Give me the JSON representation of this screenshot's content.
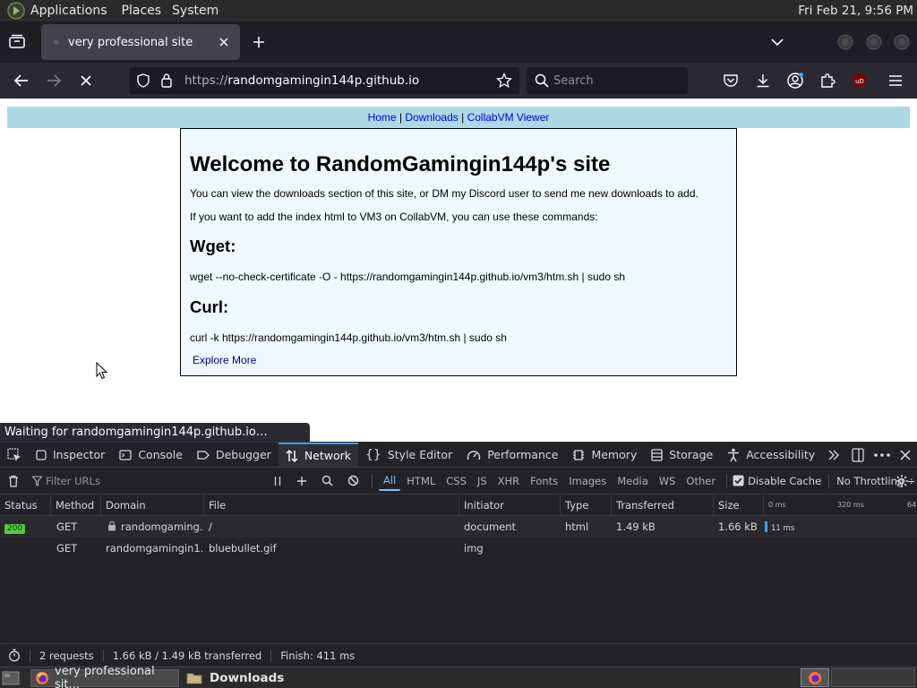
{
  "panel": {
    "menus": [
      "Applications",
      "Places",
      "System"
    ],
    "clock": "Fri Feb 21,  9:56 PM"
  },
  "tab": {
    "title": "very professional site"
  },
  "navbar": {
    "url_prefix": "https://",
    "url_host": "randomgamingin144p.github.io",
    "search_placeholder": "Search"
  },
  "page": {
    "nav": {
      "home": "Home",
      "sep1": " | ",
      "downloads": "Downloads",
      "sep2": " | ",
      "collabvm": "CollabVM Viewer"
    },
    "heading": "Welcome to RandomGamingin144p's site",
    "p1": "You can view the downloads section of this site, or DM my Discord user to send me new downloads to add.",
    "p2": "If you want to add the index html to VM3 on CollabVM, you can use these commands:",
    "wget_heading": "Wget:",
    "wget_cmd": "wget --no-check-certificate -O - https://randomgamingin144p.github.io/vm3/htm.sh | sudo sh",
    "curl_heading": "Curl:",
    "curl_cmd": "curl -k https://randomgamingin144p.github.io/vm3/htm.sh | sudo sh",
    "explore": "Explore More"
  },
  "status_popup": "Waiting for randomgamingin144p.github.io…",
  "devtools": {
    "tabs": [
      "Inspector",
      "Console",
      "Debugger",
      "Network",
      "Style Editor",
      "Performance",
      "Memory",
      "Storage",
      "Accessibility"
    ],
    "active_tab": "Network",
    "filter_placeholder": "Filter URLs",
    "filter_types": [
      "All",
      "HTML",
      "CSS",
      "JS",
      "XHR",
      "Fonts",
      "Images",
      "Media",
      "WS",
      "Other"
    ],
    "disable_cache": "Disable Cache",
    "throttling": "No Throttling ÷",
    "columns": [
      "Status",
      "Method",
      "Domain",
      "File",
      "Initiator",
      "Type",
      "Transferred",
      "Size"
    ],
    "timeline_ticks": [
      "0 ms",
      "320 ms",
      "64"
    ],
    "rows": [
      {
        "status": "200",
        "method": "GET",
        "domain": "randomgaming...",
        "file": "/",
        "initiator": "document",
        "type": "html",
        "transferred": "1.49 kB",
        "size": "1.66 kB",
        "timing": "11 ms"
      },
      {
        "status": "",
        "method": "GET",
        "domain": "randomgamingin1...",
        "file": "bluebullet.gif",
        "initiator": "img",
        "type": "",
        "transferred": "",
        "size": "",
        "timing": ""
      }
    ],
    "footer": {
      "requests": "2 requests",
      "sizes": "1.66 kB / 1.49 kB transferred",
      "finish": "Finish: 411 ms"
    }
  },
  "taskbar": {
    "task1": "very professional sit...",
    "task2": "Downloads"
  },
  "colors": {
    "accent": "#3b9ff2",
    "status_ok": "#58c83e",
    "page_nav_bg": "#add8e6",
    "page_box_bg": "#f0f8ff"
  }
}
